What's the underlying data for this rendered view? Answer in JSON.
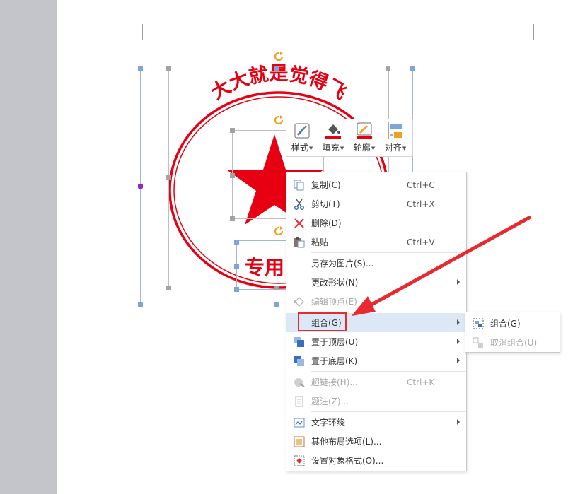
{
  "document": {
    "stamp": {
      "arc_text": "大大就是觉得飞",
      "bottom_text": "专用",
      "color": "#e60012"
    }
  },
  "mini_toolbar": {
    "items": [
      {
        "label": "样式",
        "icon": "style-icon"
      },
      {
        "label": "填充",
        "icon": "fill-bucket-icon"
      },
      {
        "label": "轮廓",
        "icon": "outline-pen-icon"
      },
      {
        "label": "对齐",
        "icon": "align-icon"
      }
    ]
  },
  "context_menu": {
    "items": [
      {
        "label": "复制(C)",
        "shortcut": "Ctrl+C",
        "icon": "copy-icon"
      },
      {
        "label": "剪切(T)",
        "shortcut": "Ctrl+X",
        "icon": "scissors-icon"
      },
      {
        "label": "删除(D)",
        "shortcut": "",
        "icon": "delete-x-icon"
      },
      {
        "label": "粘贴",
        "shortcut": "Ctrl+V",
        "icon": "paste-icon"
      },
      {
        "label": "另存为图片(S)...",
        "shortcut": "",
        "icon": ""
      },
      {
        "label": "更改形状(N)",
        "shortcut": "",
        "icon": ""
      },
      {
        "label": "编辑顶点(E)",
        "shortcut": "",
        "icon": "edit-points-icon",
        "disabled": true
      },
      {
        "label": "组合(G)",
        "shortcut": "",
        "icon": "",
        "highlighted": true
      },
      {
        "label": "置于顶层(U)",
        "shortcut": "",
        "icon": "bring-to-front-icon"
      },
      {
        "label": "置于底层(K)",
        "shortcut": "",
        "icon": "send-to-back-icon"
      },
      {
        "label": "超链接(H)...",
        "shortcut": "Ctrl+K",
        "icon": "hyperlink-icon",
        "disabled": true
      },
      {
        "label": "题注(Z)...",
        "shortcut": "",
        "icon": "caption-icon",
        "disabled": true
      },
      {
        "label": "文字环绕",
        "shortcut": "",
        "icon": "text-wrap-icon"
      },
      {
        "label": "其他布局选项(L)...",
        "shortcut": "",
        "icon": "layout-options-icon"
      },
      {
        "label": "设置对象格式(O)...",
        "shortcut": "",
        "icon": "format-object-icon"
      }
    ]
  },
  "submenu": {
    "items": [
      {
        "label": "组合(G)",
        "icon": "group-icon"
      },
      {
        "label": "取消组合(U)",
        "icon": "ungroup-icon",
        "disabled": true
      }
    ]
  },
  "colors": {
    "accent_red": "#e8292f",
    "menu_highlight": "#dce8f6",
    "selection_handle": "#7ea4d9"
  }
}
